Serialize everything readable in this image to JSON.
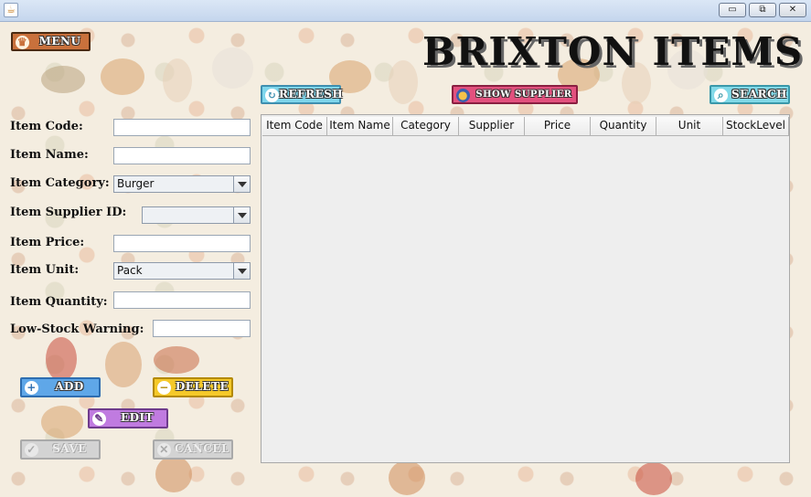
{
  "window": {
    "app_icon": "java-icon",
    "minimize_label": "▭",
    "restore_label": "⧉",
    "close_label": "✕"
  },
  "header": {
    "title": "BRIXTON ITEMS",
    "menu_label": "MENU"
  },
  "toolbar": {
    "refresh_label": "REFRESH",
    "show_supplier_label": "SHOW SUPPLIER",
    "search_label": "SEARCH"
  },
  "form": {
    "item_code_label": "Item Code:",
    "item_code_value": "",
    "item_name_label": "Item Name:",
    "item_name_value": "",
    "item_category_label": "Item Category:",
    "item_category_value": "Burger",
    "item_supplier_label": "Item Supplier ID:",
    "item_supplier_value": "",
    "item_price_label": "Item Price:",
    "item_price_value": "",
    "item_unit_label": "Item Unit:",
    "item_unit_value": "Pack",
    "item_quantity_label": "Item Quantity:",
    "item_quantity_value": "",
    "low_stock_label": "Low-Stock Warning:",
    "low_stock_value": ""
  },
  "actions": {
    "add_label": "ADD",
    "delete_label": "DELETE",
    "edit_label": "EDIT",
    "save_label": "SAVE",
    "cancel_label": "CANCEL"
  },
  "table": {
    "columns": [
      "Item Code",
      "Item Name",
      "Category",
      "Supplier",
      "Price",
      "Quantity",
      "Unit",
      "StockLevel"
    ],
    "rows": []
  },
  "colors": {
    "refresh_bg": "#7fd6ec",
    "show_supplier_bg": "#e2517e",
    "search_bg": "#82d9e8",
    "add_bg": "#5fa7e8",
    "delete_bg": "#f5c92a",
    "edit_bg": "#c07be0",
    "disabled_bg": "#cfcfcf"
  }
}
